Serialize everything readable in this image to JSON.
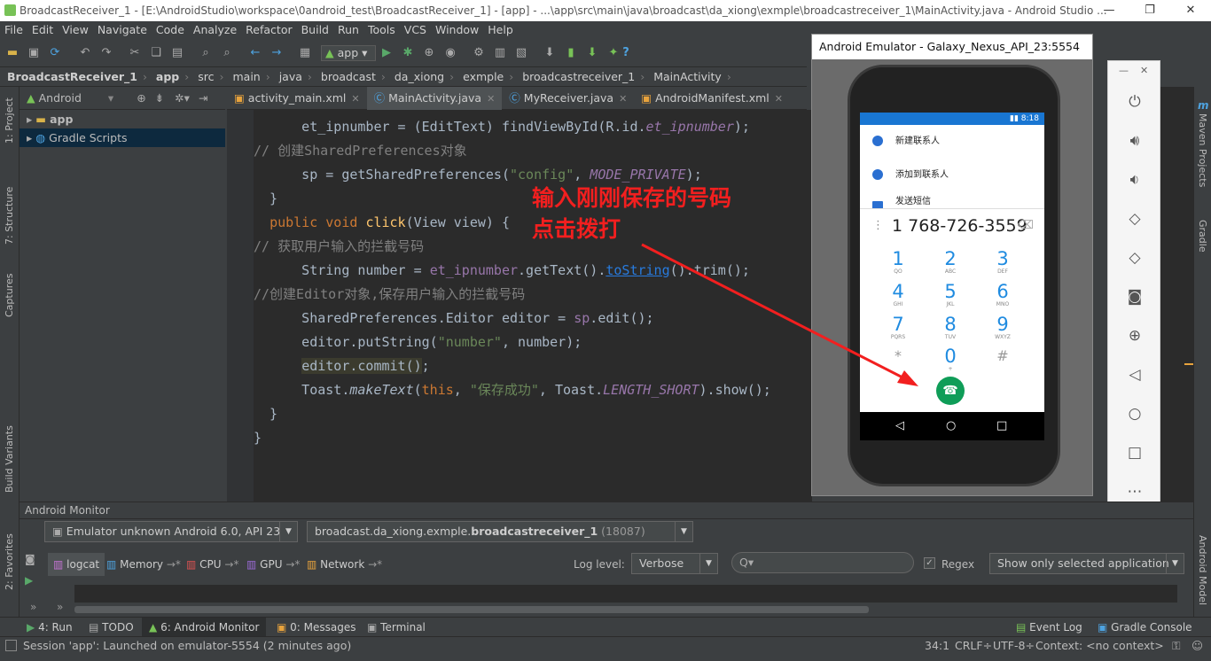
{
  "window": {
    "title": "BroadcastReceiver_1 - [E:\\AndroidStudio\\workspace\\0android_test\\BroadcastReceiver_1] - [app] - ...\\app\\src\\main\\java\\broadcast\\da_xiong\\exmple\\broadcastreceiver_1\\MainActivity.java - Android Studio ..."
  },
  "menu": [
    "File",
    "Edit",
    "View",
    "Navigate",
    "Code",
    "Analyze",
    "Refactor",
    "Build",
    "Run",
    "Tools",
    "VCS",
    "Window",
    "Help"
  ],
  "toolbar": {
    "run_config": "app"
  },
  "breadcrumb": [
    "BroadcastReceiver_1",
    "app",
    "src",
    "main",
    "java",
    "broadcast",
    "da_xiong",
    "exmple",
    "broadcastreceiver_1",
    "MainActivity"
  ],
  "left_strip": [
    "1: Project",
    "7: Structure",
    "Captures",
    "Build Variants",
    "2: Favorites"
  ],
  "right_strip": [
    "Maven Projects",
    "Gradle",
    "Android Model"
  ],
  "project": {
    "view": "Android",
    "items": [
      "app",
      "Gradle Scripts"
    ]
  },
  "tabs": [
    "activity_main.xml",
    "MainActivity.java",
    "MyReceiver.java",
    "AndroidManifest.xml"
  ],
  "emulator": {
    "title": "Android Emulator - Galaxy_Nexus_API_23:5554",
    "time": "8:18",
    "contacts": [
      "新建联系人",
      "添加到联系人",
      "发送短信"
    ],
    "dialed_number": "1 768-726-3559",
    "keys": [
      {
        "d": "1",
        "s": "QO"
      },
      {
        "d": "2",
        "s": "ABC"
      },
      {
        "d": "3",
        "s": "DEF"
      },
      {
        "d": "4",
        "s": "GHI"
      },
      {
        "d": "5",
        "s": "JKL"
      },
      {
        "d": "6",
        "s": "MNO"
      },
      {
        "d": "7",
        "s": "PQRS"
      },
      {
        "d": "8",
        "s": "TUV"
      },
      {
        "d": "9",
        "s": "WXYZ"
      },
      {
        "d": "*",
        "s": ""
      },
      {
        "d": "0",
        "s": "+"
      },
      {
        "d": "#",
        "s": ""
      }
    ]
  },
  "annotation": {
    "line1": "输入刚刚保存的号码",
    "line2": "点击拨打"
  },
  "monitor": {
    "title": "Android Monitor",
    "device": "Emulator unknown Android 6.0, API 23",
    "process_prefix": "broadcast.da_xiong.exmple.",
    "process_bold": "broadcastreceiver_1",
    "process_pid": "(18087)",
    "tabs": [
      "logcat",
      "Memory",
      "CPU",
      "GPU",
      "Network"
    ],
    "log_level_label": "Log level:",
    "log_level": "Verbose",
    "search_placeholder": "Q▾",
    "regex_label": "Regex",
    "filter": "Show only selected application"
  },
  "bottom_tabs": [
    "4: Run",
    "TODO",
    "6: Android Monitor",
    "0: Messages",
    "Terminal"
  ],
  "bottom_right_tabs": [
    "Event Log",
    "Gradle Console"
  ],
  "status": {
    "message": "Session 'app': Launched on emulator-5554 (2 minutes ago)",
    "position": "34:1",
    "line_sep": "CRLF÷",
    "encoding": "UTF-8÷",
    "context": "Context: <no context>"
  }
}
